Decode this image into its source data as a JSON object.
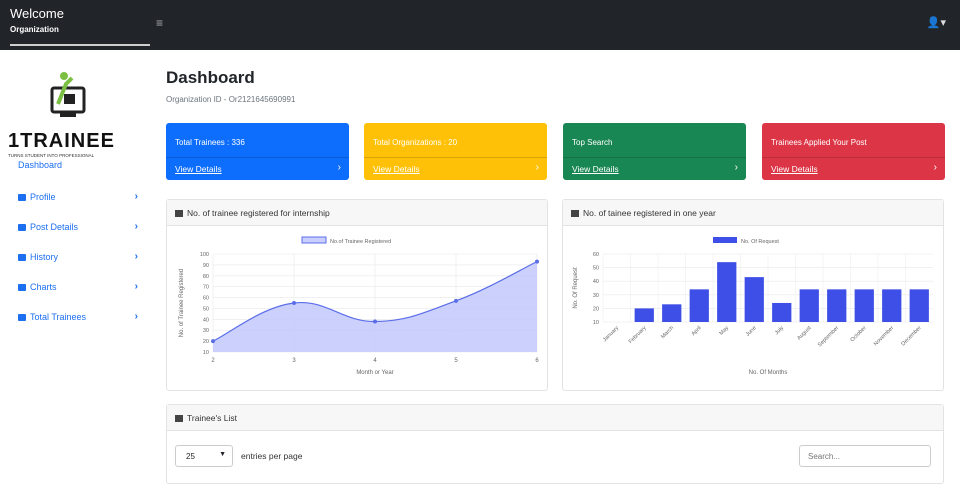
{
  "topbar": {
    "welcome": "Welcome",
    "org": "Organization",
    "toggle_icon": "≡",
    "user_icon": "👤▾"
  },
  "sidebar": {
    "logo_text": "1TRAINEE",
    "logo_tagline": "TURNS STUDENT INTO PROFESSIONAL",
    "items": [
      {
        "label": "Dashboard"
      },
      {
        "label": "Profile",
        "chevron": "›"
      },
      {
        "label": "Post Details",
        "chevron": "›"
      },
      {
        "label": "History",
        "chevron": "›"
      },
      {
        "label": "Charts",
        "chevron": "›"
      },
      {
        "label": "Total Trainees",
        "chevron": "›"
      }
    ]
  },
  "main": {
    "title": "Dashboard",
    "org_id": "Organization ID - Or2121645690991",
    "cards": [
      {
        "title": "Total Trainees  :  336",
        "link": "View Details",
        "color": "#0d6efd"
      },
      {
        "title": "Total Organizations  :  20",
        "link": "View Details",
        "color": "#ffc107"
      },
      {
        "title": "Top Search",
        "link": "View Details",
        "color": "#198754"
      },
      {
        "title": "Trainees Applied Your Post",
        "link": "View Details",
        "color": "#dc3545"
      }
    ]
  },
  "charts": {
    "left_title": "No. of trainee registered for internship",
    "right_title": "No. of tainee registered in one year"
  },
  "chart_data": [
    {
      "type": "area",
      "title": "",
      "legend": "No.of Trainee Registered",
      "xlabel": "Month or Year",
      "ylabel": "No. of Trainee Registered",
      "x": [
        2,
        3,
        4,
        5,
        6
      ],
      "series": [
        {
          "name": "No.of Trainee Registered",
          "values": [
            20,
            55,
            38,
            57,
            93
          ]
        }
      ],
      "ylim": [
        10,
        100
      ],
      "yticks": [
        10,
        20,
        30,
        40,
        50,
        60,
        70,
        80,
        90,
        100
      ],
      "grid": true,
      "color": "#5b6ee8"
    },
    {
      "type": "bar",
      "title": "",
      "legend": "No. Of Request",
      "xlabel": "No. Of Months",
      "ylabel": "No. Of Request",
      "categories": [
        "January",
        "February",
        "March",
        "April",
        "May",
        "June",
        "July",
        "August",
        "September",
        "October",
        "November",
        "December"
      ],
      "series": [
        {
          "name": "No. Of Request",
          "values": [
            10,
            20,
            23,
            34,
            54,
            43,
            24,
            34,
            34,
            34,
            34,
            34
          ]
        }
      ],
      "ylim": [
        10,
        60
      ],
      "yticks": [
        10,
        20,
        30,
        40,
        50,
        60
      ],
      "grid": true,
      "color": "#3d4fe6"
    }
  ],
  "list": {
    "title": "Trainee's List",
    "page_size": "25",
    "entries_label": "entries per page",
    "search_placeholder": "Search..."
  }
}
